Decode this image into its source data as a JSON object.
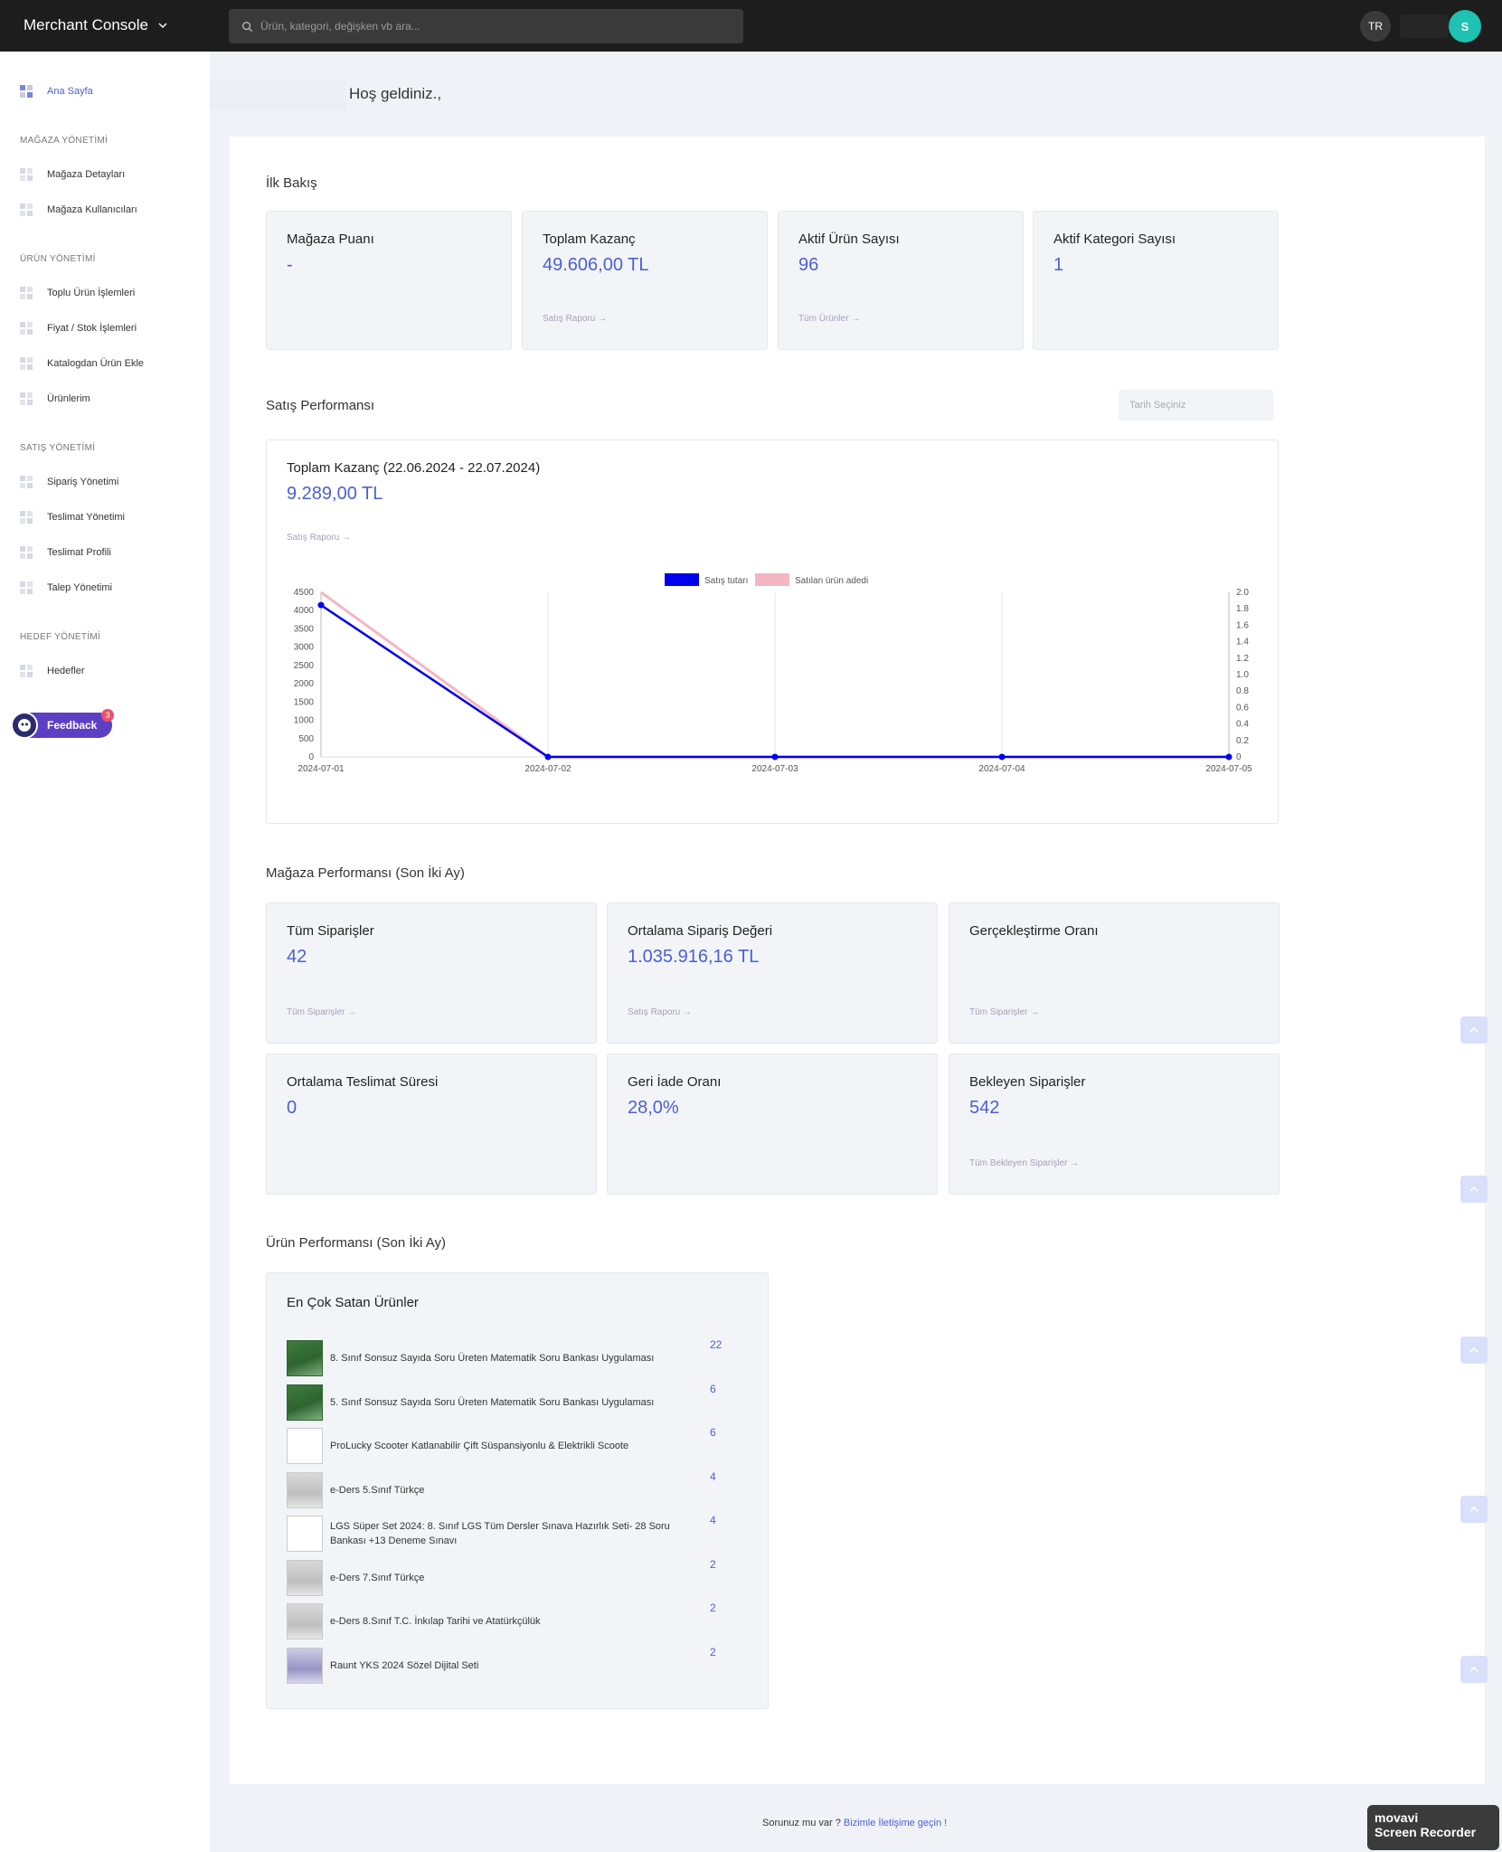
{
  "topbar": {
    "brand": "Merchant Console",
    "search_placeholder": "Ürün, kategori, değişken vb ara...",
    "lang": "TR",
    "avatar_initial": "S"
  },
  "sidebar": {
    "home": "Ana Sayfa",
    "sections": [
      {
        "title": "MAĞAZA YÖNETİMİ",
        "items": [
          "Mağaza Detayları",
          "Mağaza Kullanıcıları"
        ]
      },
      {
        "title": "ÜRÜN YÖNETİMİ",
        "items": [
          "Toplu Ürün İşlemleri",
          "Fiyat / Stok İşlemleri",
          "Katalogdan Ürün Ekle",
          "Ürünlerim"
        ]
      },
      {
        "title": "SATIŞ YÖNETİMİ",
        "items": [
          "Sipariş Yönetimi",
          "Teslimat Yönetimi",
          "Teslimat Profili",
          "Talep Yönetimi"
        ]
      },
      {
        "title": "HEDEF YÖNETİMİ",
        "items": [
          "Hedefler"
        ]
      }
    ],
    "feedback_label": "Feedback",
    "feedback_badge": "3"
  },
  "welcome": "Hoş geldiniz.,",
  "overview": {
    "title": "İlk Bakış",
    "cards": [
      {
        "title": "Mağaza Puanı",
        "value": "-",
        "link": ""
      },
      {
        "title": "Toplam Kazanç",
        "value": "49.606,00 TL",
        "link": "Satış Raporu →"
      },
      {
        "title": "Aktif Ürün Sayısı",
        "value": "96",
        "link": "Tüm Ürünler →"
      },
      {
        "title": "Aktif Kategori Sayısı",
        "value": "1",
        "link": ""
      }
    ]
  },
  "sales": {
    "title": "Satış Performansı",
    "date_placeholder": "Tarih Seçiniz",
    "chart_title": "Toplam Kazanç (22.06.2024 - 22.07.2024)",
    "chart_value": "9.289,00 TL",
    "chart_link": "Satış Raporu →"
  },
  "chart_data": {
    "type": "line",
    "x": [
      "2024-07-01",
      "2024-07-02",
      "2024-07-03",
      "2024-07-04",
      "2024-07-05"
    ],
    "series": [
      {
        "name": "Satış tutarı",
        "values": [
          4150,
          0,
          0,
          0,
          0
        ],
        "color": "#0000ee",
        "axis": "left"
      },
      {
        "name": "Satılan ürün adedi",
        "values": [
          2.0,
          0,
          0,
          0,
          0
        ],
        "color": "#f4b6c2",
        "axis": "right"
      }
    ],
    "y_left": {
      "min": 0,
      "max": 4500,
      "ticks": [
        "0",
        "500",
        "1000",
        "1500",
        "2000",
        "2500",
        "3000",
        "3500",
        "4000",
        "4500"
      ]
    },
    "y_right": {
      "min": 0,
      "max": 2.0,
      "ticks": [
        "0",
        "0.2",
        "0.4",
        "0.6",
        "0.8",
        "1.0",
        "1.2",
        "1.4",
        "1.6",
        "1.8",
        "2.0"
      ]
    },
    "legend_placement": "top-center",
    "grid": "vertical"
  },
  "store_perf": {
    "title": "Mağaza Performansı (Son İki Ay)",
    "cards": [
      {
        "title": "Tüm Siparişler",
        "value": "42",
        "link": "Tüm Siparişler →"
      },
      {
        "title": "Ortalama Sipariş Değeri",
        "value": "1.035.916,16 TL",
        "link": "Satış Raporu →"
      },
      {
        "title": "Gerçekleştirme Oranı",
        "value": "",
        "link": "Tüm Siparişler →"
      },
      {
        "title": "Ortalama Teslimat Süresi",
        "value": "0",
        "link": ""
      },
      {
        "title": "Geri İade Oranı",
        "value": "28,0%",
        "link": ""
      },
      {
        "title": "Bekleyen Siparişler",
        "value": "542",
        "link": "Tüm Bekleyen Siparişler →"
      }
    ]
  },
  "product_perf": {
    "title": "Ürün Performansı (Son İki Ay)",
    "card_title": "En Çok Satan Ürünler",
    "items": [
      {
        "name": "8. Sınıf Sonsuz Sayıda Soru Üreten Matematik Soru Bankası Uygulaması",
        "count": "22",
        "thumb": "green"
      },
      {
        "name": "5. Sınıf Sonsuz Sayıda Soru Üreten Matematik Soru Bankası Uygulaması",
        "count": "6",
        "thumb": "green"
      },
      {
        "name": "ProLucky Scooter Katlanabilir Çift Süspansiyonlu & Elektrikli Scoote",
        "count": "6",
        "thumb": "blank"
      },
      {
        "name": "e-Ders 5.Sınıf Türkçe",
        "count": "4",
        "thumb": "gray"
      },
      {
        "name": "LGS Süper Set 2024: 8. Sınıf LGS Tüm Dersler Sınava Hazırlık Seti- 28 Soru Bankası +13 Deneme Sınavı",
        "count": "4",
        "thumb": "blank"
      },
      {
        "name": "e-Ders 7.Sınıf Türkçe",
        "count": "2",
        "thumb": "gray"
      },
      {
        "name": "e-Ders 8.Sınıf T.C. İnkılap Tarihi ve Atatürkçülük",
        "count": "2",
        "thumb": "gray"
      },
      {
        "name": "Raunt YKS 2024 Sözel Dijital Seti",
        "count": "2",
        "thumb": "purple"
      }
    ]
  },
  "footer": {
    "text": "Sorunuz mu var ?",
    "link": "Bizimle İletişime geçin !"
  },
  "watermark": {
    "line1": "movavi",
    "line2": "Screen Recorder"
  },
  "colors": {
    "accent": "#4b5fd4",
    "topbar": "#1d1d1d",
    "avatar": "#1ec1b2",
    "feedback": "#5b3fc4"
  }
}
